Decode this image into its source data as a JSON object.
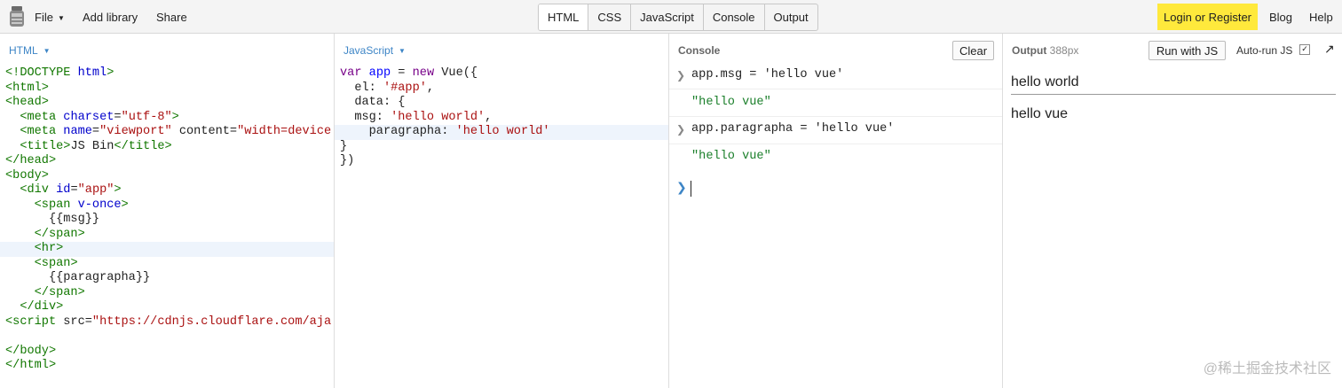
{
  "toolbar": {
    "file_label": "File",
    "add_library_label": "Add library",
    "share_label": "Share",
    "panel_tabs": [
      "HTML",
      "CSS",
      "JavaScript",
      "Console",
      "Output"
    ],
    "login_label": "Login or Register",
    "blog_label": "Blog",
    "help_label": "Help"
  },
  "html_panel": {
    "label": "HTML",
    "lines": [
      "<!DOCTYPE html>",
      "<html>",
      "<head>",
      "  <meta charset=\"utf-8\">",
      "  <meta name=\"viewport\" content=\"width=device",
      "  <title>JS Bin</title>",
      "</head>",
      "<body>",
      "  <div id=\"app\">",
      "    <span v-once>",
      "      {{msg}}",
      "    </span>",
      "    <hr>",
      "    <span>",
      "      {{paragrapha}}",
      "    </span>",
      "  </div>",
      "<script src=\"https://cdnjs.cloudflare.com/aja",
      "",
      "</body>",
      "</html>"
    ]
  },
  "js_panel": {
    "label": "JavaScript",
    "lines": [
      "var app = new Vue({",
      "  el: '#app',",
      "  data: {",
      "  msg: 'hello world',",
      "    paragrapha: 'hello world'",
      "}",
      "})"
    ]
  },
  "console_panel": {
    "title": "Console",
    "clear_label": "Clear",
    "entries": [
      {
        "input": "app.msg = 'hello vue'",
        "result": "\"hello vue\""
      },
      {
        "input": "app.paragrapha = 'hello vue'",
        "result": "\"hello vue\""
      }
    ],
    "prompt_symbol": "❯"
  },
  "output_panel": {
    "title": "Output",
    "size": "388px",
    "run_label": "Run with JS",
    "autorun_label": "Auto-run JS",
    "autorun_checked": true,
    "line1": "hello world",
    "line2": "hello vue"
  },
  "watermark": "@稀土掘金技术社区",
  "icons": {
    "logo": "jsbin-logo-icon",
    "caret": "caret-down-icon",
    "chevron": "chevron-right-icon",
    "popout": "popout-arrow-icon",
    "checkbox": "checkbox-icon"
  },
  "colors": {
    "accent": "#3d85c6",
    "login_bg": "#ffe93c",
    "console_result": "#1a7f2a"
  }
}
